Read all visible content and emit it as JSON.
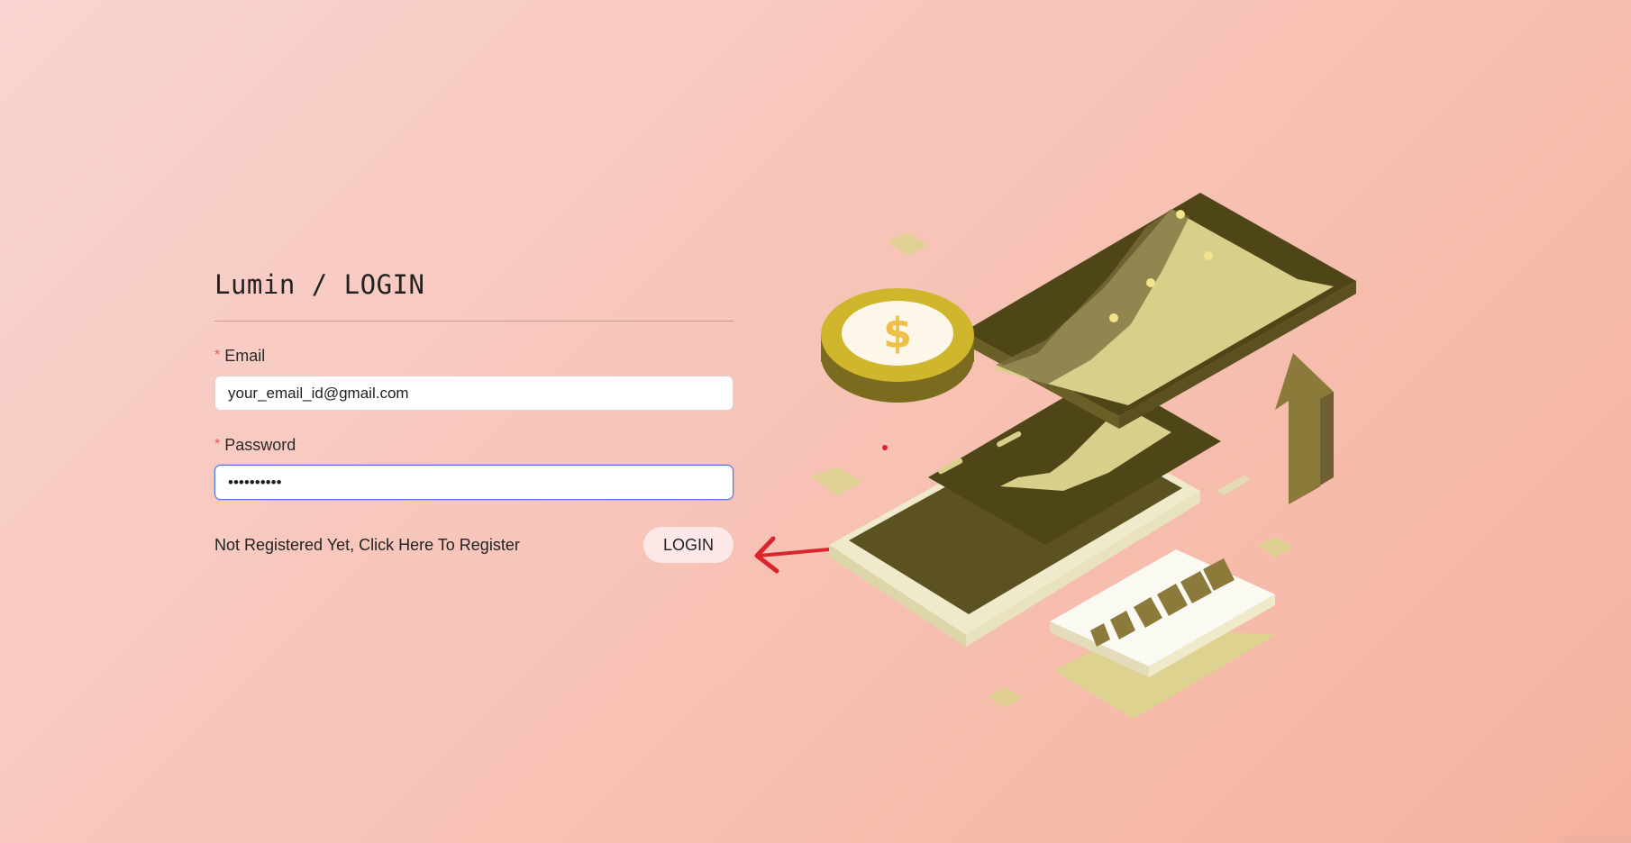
{
  "app": {
    "title": "Lumin / LOGIN"
  },
  "form": {
    "email": {
      "label": "Email",
      "required_mark": "*",
      "value": "your_email_id@gmail.com"
    },
    "password": {
      "label": "Password",
      "required_mark": "*",
      "value": "••••••••••"
    },
    "register_link": "Not Registered Yet, Click Here To Register",
    "login_button": "LOGIN"
  },
  "illustration": {
    "coin_symbol": "$",
    "icon": "finance-phone-illustration"
  },
  "colors": {
    "background_start": "#f9d4d0",
    "background_end": "#f5b29e",
    "accent_olive": "#4f4618",
    "accent_khaki": "#d8d08a",
    "coin_gold": "#cfb62c",
    "annotation_red": "#d9262e",
    "focus_blue": "#4b7be5"
  }
}
